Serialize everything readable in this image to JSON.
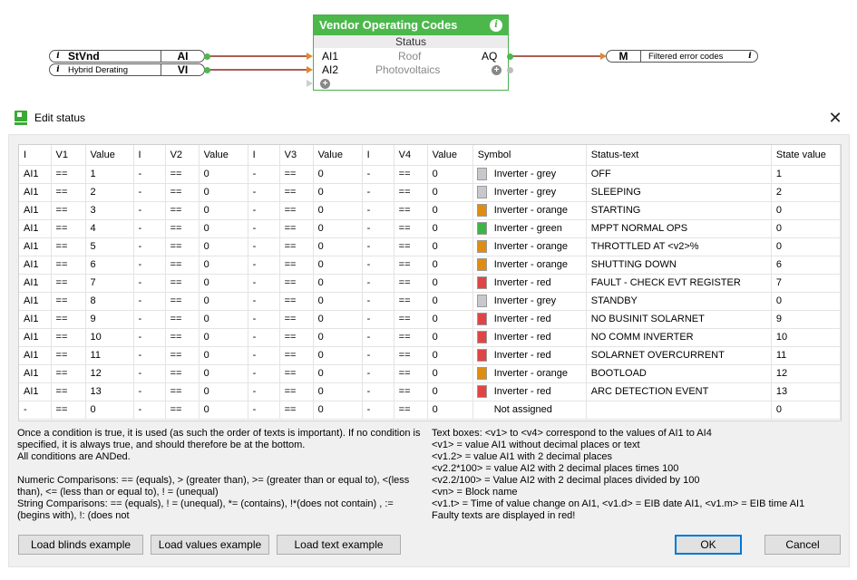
{
  "diagram": {
    "inputs": [
      {
        "info": "i",
        "name": "StVnd",
        "type": "AI",
        "big": true
      },
      {
        "info": "i",
        "name": "Hybrid Derating",
        "type": "VI",
        "big": false
      }
    ],
    "block": {
      "title": "Vendor Operating Codes",
      "info": "i",
      "subtitle": "Status",
      "in_ports": [
        "AI1",
        "AI2"
      ],
      "out_port": "AQ",
      "desc_lines": [
        "Roof",
        "Photovoltaics"
      ]
    },
    "output": {
      "type": "M",
      "name": "Filtered error codes",
      "info": "i"
    },
    "colors": {
      "block_green": "#4cb84c",
      "wire": "#8b2a1f",
      "connector": "#e08a2c",
      "port_green": "#4cb84c",
      "port_grey": "#bdbdbd"
    }
  },
  "dialog": {
    "title": "Edit status",
    "close_glyph": "✕",
    "table": {
      "headers": [
        "I",
        "V1",
        "Value",
        "I",
        "V2",
        "Value",
        "I",
        "V3",
        "Value",
        "I",
        "V4",
        "Value",
        "Symbol",
        "Status-text",
        "State value"
      ],
      "rows": [
        {
          "i1": "AI1",
          "v1": "==",
          "val1": "1",
          "i2": "-",
          "v2": "==",
          "val2": "0",
          "i3": "-",
          "v3": "==",
          "val3": "0",
          "i4": "-",
          "v4": "==",
          "val4": "0",
          "symbol": "Inverter - grey",
          "color": "#c8c8cc",
          "status": "OFF",
          "state": "1"
        },
        {
          "i1": "AI1",
          "v1": "==",
          "val1": "2",
          "i2": "-",
          "v2": "==",
          "val2": "0",
          "i3": "-",
          "v3": "==",
          "val3": "0",
          "i4": "-",
          "v4": "==",
          "val4": "0",
          "symbol": "Inverter - grey",
          "color": "#c8c8cc",
          "status": "SLEEPING",
          "state": "2"
        },
        {
          "i1": "AI1",
          "v1": "==",
          "val1": "3",
          "i2": "-",
          "v2": "==",
          "val2": "0",
          "i3": "-",
          "v3": "==",
          "val3": "0",
          "i4": "-",
          "v4": "==",
          "val4": "0",
          "symbol": "Inverter - orange",
          "color": "#e08c10",
          "status": "STARTING",
          "state": "0"
        },
        {
          "i1": "AI1",
          "v1": "==",
          "val1": "4",
          "i2": "-",
          "v2": "==",
          "val2": "0",
          "i3": "-",
          "v3": "==",
          "val3": "0",
          "i4": "-",
          "v4": "==",
          "val4": "0",
          "symbol": "Inverter - green",
          "color": "#3cb544",
          "status": "MPPT NORMAL OPS",
          "state": "0"
        },
        {
          "i1": "AI1",
          "v1": "==",
          "val1": "5",
          "i2": "-",
          "v2": "==",
          "val2": "0",
          "i3": "-",
          "v3": "==",
          "val3": "0",
          "i4": "-",
          "v4": "==",
          "val4": "0",
          "symbol": "Inverter - orange",
          "color": "#e08c10",
          "status": "THROTTLED AT <v2>%",
          "state": "0"
        },
        {
          "i1": "AI1",
          "v1": "==",
          "val1": "6",
          "i2": "-",
          "v2": "==",
          "val2": "0",
          "i3": "-",
          "v3": "==",
          "val3": "0",
          "i4": "-",
          "v4": "==",
          "val4": "0",
          "symbol": "Inverter - orange",
          "color": "#e08c10",
          "status": "SHUTTING DOWN",
          "state": "6"
        },
        {
          "i1": "AI1",
          "v1": "==",
          "val1": "7",
          "i2": "-",
          "v2": "==",
          "val2": "0",
          "i3": "-",
          "v3": "==",
          "val3": "0",
          "i4": "-",
          "v4": "==",
          "val4": "0",
          "symbol": "Inverter - red",
          "color": "#e04545",
          "status": "FAULT - CHECK EVT REGISTER",
          "state": "7"
        },
        {
          "i1": "AI1",
          "v1": "==",
          "val1": "8",
          "i2": "-",
          "v2": "==",
          "val2": "0",
          "i3": "-",
          "v3": "==",
          "val3": "0",
          "i4": "-",
          "v4": "==",
          "val4": "0",
          "symbol": "Inverter - grey",
          "color": "#c8c8cc",
          "status": "STANDBY",
          "state": "0"
        },
        {
          "i1": "AI1",
          "v1": "==",
          "val1": "9",
          "i2": "-",
          "v2": "==",
          "val2": "0",
          "i3": "-",
          "v3": "==",
          "val3": "0",
          "i4": "-",
          "v4": "==",
          "val4": "0",
          "symbol": "Inverter - red",
          "color": "#e04545",
          "status": "NO BUSINIT SOLARNET",
          "state": "9"
        },
        {
          "i1": "AI1",
          "v1": "==",
          "val1": "10",
          "i2": "-",
          "v2": "==",
          "val2": "0",
          "i3": "-",
          "v3": "==",
          "val3": "0",
          "i4": "-",
          "v4": "==",
          "val4": "0",
          "symbol": "Inverter - red",
          "color": "#e04545",
          "status": "NO COMM INVERTER",
          "state": "10"
        },
        {
          "i1": "AI1",
          "v1": "==",
          "val1": "11",
          "i2": "-",
          "v2": "==",
          "val2": "0",
          "i3": "-",
          "v3": "==",
          "val3": "0",
          "i4": "-",
          "v4": "==",
          "val4": "0",
          "symbol": "Inverter - red",
          "color": "#e04545",
          "status": "SOLARNET OVERCURRENT",
          "state": "11"
        },
        {
          "i1": "AI1",
          "v1": "==",
          "val1": "12",
          "i2": "-",
          "v2": "==",
          "val2": "0",
          "i3": "-",
          "v3": "==",
          "val3": "0",
          "i4": "-",
          "v4": "==",
          "val4": "0",
          "symbol": "Inverter - orange",
          "color": "#e08c10",
          "status": "BOOTLOAD",
          "state": "12"
        },
        {
          "i1": "AI1",
          "v1": "==",
          "val1": "13",
          "i2": "-",
          "v2": "==",
          "val2": "0",
          "i3": "-",
          "v3": "==",
          "val3": "0",
          "i4": "-",
          "v4": "==",
          "val4": "0",
          "symbol": "Inverter - red",
          "color": "#e04545",
          "status": "ARC DETECTION EVENT",
          "state": "13"
        },
        {
          "i1": "-",
          "v1": "==",
          "val1": "0",
          "i2": "-",
          "v2": "==",
          "val2": "0",
          "i3": "-",
          "v3": "==",
          "val3": "0",
          "i4": "-",
          "v4": "==",
          "val4": "0",
          "symbol": "Not assigned",
          "color": "",
          "status": "",
          "state": "0"
        }
      ]
    },
    "help_left": [
      "Once a condition is true, it is used (as such the order of texts is important). If no condition is specified, it is always true, and should therefore be at the bottom.",
      "All conditions are ANDed.",
      "",
      "Numeric Comparisons: == (equals), > (greater than), >= (greater than or equal to), <(less than), <= (less than or equal to), ! = (unequal)",
      "String Comparisons: == (equals), ! = (unequal), *= (contains), !*(does not contain) , := (begins with), !: (does not"
    ],
    "help_right": [
      "Text boxes: <v1> to <v4> correspond to the values of AI1 to AI4",
      "<v1> = value AI1 without decimal places or text",
      "<v1.2> = value AI1 with 2 decimal places",
      "<v2.2*100> = value AI2 with 2 decimal places times 100",
      "<v2.2/100> = Value AI2 with 2 decimal places divided by 100",
      "<vn> = Block name",
      "<v1.t> = Time of value change on AI1, <v1.d> = EIB date AI1, <v1.m> = EIB time AI1",
      "Faulty texts are displayed in red!"
    ],
    "buttons": {
      "load_blinds": "Load blinds example",
      "load_values": "Load values example",
      "load_text": "Load text example",
      "ok": "OK",
      "cancel": "Cancel"
    }
  }
}
